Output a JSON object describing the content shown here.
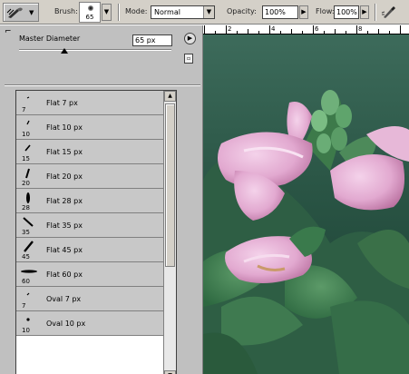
{
  "options_bar": {
    "brush_label": "Brush:",
    "brush_size": "65",
    "mode_label": "Mode:",
    "mode_value": "Normal",
    "opacity_label": "Opacity:",
    "opacity_value": "100%",
    "flow_label": "Flow:",
    "flow_value": "100%"
  },
  "brushes_palette": {
    "master_diameter_label": "Master Diameter",
    "master_diameter_value": "65 px",
    "master_diameter_slider_level": 0.3,
    "brushes": [
      {
        "size": "7",
        "name": "Flat 7 px"
      },
      {
        "size": "10",
        "name": "Flat 10 px"
      },
      {
        "size": "15",
        "name": "Flat 15 px"
      },
      {
        "size": "20",
        "name": "Flat 20 px"
      },
      {
        "size": "28",
        "name": "Flat 28 px"
      },
      {
        "size": "35",
        "name": "Flat 35 px"
      },
      {
        "size": "45",
        "name": "Flat 45 px"
      },
      {
        "size": "60",
        "name": "Flat 60 px"
      },
      {
        "size": "7",
        "name": "Oval 7 px"
      },
      {
        "size": "10",
        "name": "Oval 10 px"
      }
    ]
  },
  "ruler": {
    "labels": [
      "2",
      "4",
      "6",
      "8"
    ]
  },
  "icons": {
    "tool_preset": "brush-tool-icon",
    "palette_menu": "palette-menu-icon",
    "new_preset": "new-preset-icon",
    "airbrush": "airbrush-icon"
  },
  "colors": {
    "panel": "#c0c0c0",
    "leaf_dark": "#1f4f3f",
    "petal_pink": "#e8b4d8"
  }
}
